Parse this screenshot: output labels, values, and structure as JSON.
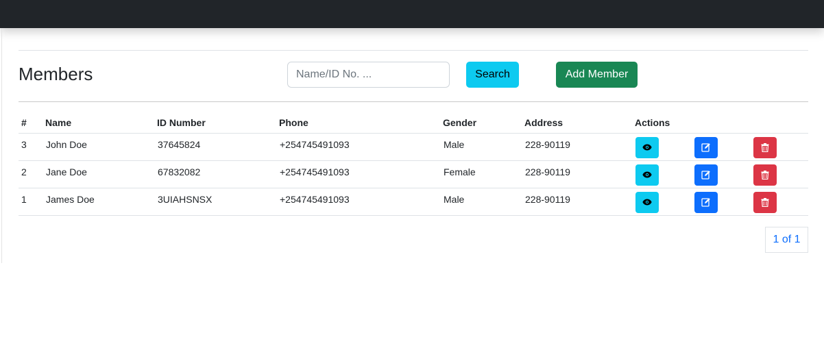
{
  "page": {
    "title": "Members"
  },
  "search": {
    "placeholder": "Name/ID No. ...",
    "value": "",
    "button_label": "Search"
  },
  "actions": {
    "add_label": "Add Member"
  },
  "table": {
    "columns": [
      "#",
      "Name",
      "ID Number",
      "Phone",
      "Gender",
      "Address",
      "Actions"
    ],
    "rows": [
      {
        "num": "3",
        "name": "John Doe",
        "id_number": "37645824",
        "phone": "+254745491093",
        "gender": "Male",
        "address": "228-90119"
      },
      {
        "num": "2",
        "name": "Jane Doe",
        "id_number": "67832082",
        "phone": "+254745491093",
        "gender": "Female",
        "address": "228-90119"
      },
      {
        "num": "1",
        "name": "James Doe",
        "id_number": "3UIAHSNSX",
        "phone": "+254745491093",
        "gender": "Male",
        "address": "228-90119"
      }
    ],
    "row_actions": [
      "eye-icon",
      "edit-icon",
      "trash-icon"
    ]
  },
  "pagination": {
    "label": "1 of 1"
  },
  "colors": {
    "navbar": "#212529",
    "info": "#0dcaf0",
    "success": "#198754",
    "primary": "#0d6efd",
    "danger": "#dc3545"
  }
}
